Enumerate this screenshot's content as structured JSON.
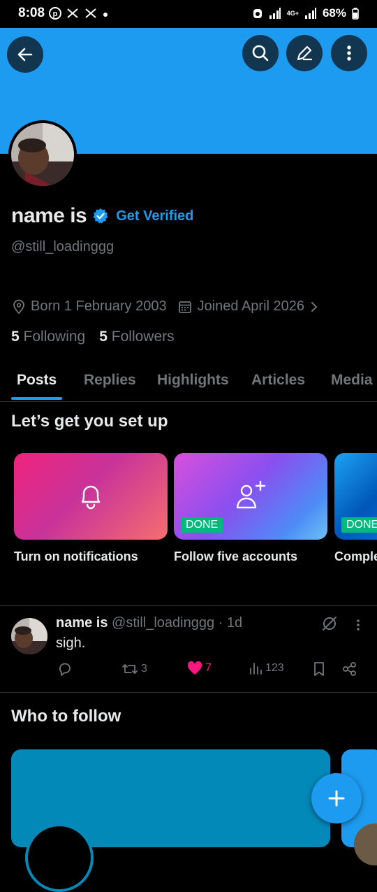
{
  "status_bar": {
    "time": "8:08",
    "network": "4G+",
    "battery": "68%"
  },
  "profile": {
    "display_name": "name is",
    "get_verified": "Get Verified",
    "handle": "@still_loadinggg",
    "born": "Born 1 February 2003",
    "joined": "Joined April 2026",
    "following_count": "5",
    "following_label": "Following",
    "followers_count": "5",
    "followers_label": "Followers"
  },
  "tabs": [
    "Posts",
    "Replies",
    "Highlights",
    "Articles",
    "Media"
  ],
  "setup": {
    "title": "Let’s get you set up",
    "cards": [
      {
        "label": "Turn on notifications",
        "icon": "bell-icon",
        "done": false
      },
      {
        "label": "Follow five accounts",
        "icon": "add-user-icon",
        "done": true,
        "badge": "DONE"
      },
      {
        "label": "Comple",
        "badge": "DONE"
      }
    ]
  },
  "post": {
    "name": "name is",
    "meta": "@still_loadinggg · 1d",
    "text": "sigh.",
    "reposts": "3",
    "likes": "7",
    "views": "123"
  },
  "who_to_follow": {
    "title": "Who to follow"
  },
  "colors": {
    "accent": "#1d9bf0",
    "like": "#f91880",
    "done": "#00ba7c",
    "muted": "#71767b"
  }
}
